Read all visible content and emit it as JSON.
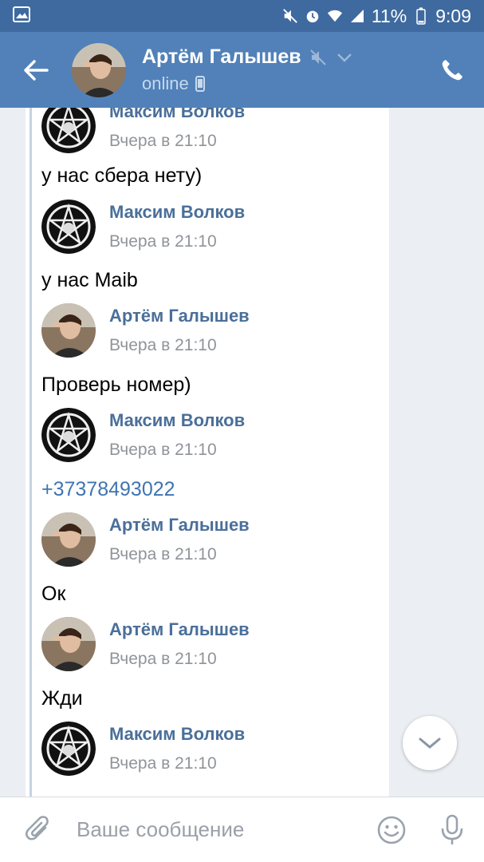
{
  "status_bar": {
    "battery": "11%",
    "time": "9:09",
    "icons": [
      "image-icon",
      "mute-icon",
      "alarm-icon",
      "wifi-icon",
      "signal-icon",
      "battery-icon"
    ]
  },
  "header": {
    "name": "Артём Галышев",
    "status": "online",
    "icons": [
      "back-arrow-icon",
      "muted-icon",
      "chevron-down-icon",
      "mobile-icon",
      "phone-icon"
    ]
  },
  "messages": [
    {
      "type": "author",
      "name": "Максим Волков",
      "time": "Вчера в 21:10",
      "avatar": "pentagram"
    },
    {
      "type": "text",
      "text": "у нас сбера нету)"
    },
    {
      "type": "author",
      "name": "Максим Волков",
      "time": "Вчера в 21:10",
      "avatar": "pentagram"
    },
    {
      "type": "text",
      "text": "у нас Maib"
    },
    {
      "type": "author",
      "name": "Артём Галышев",
      "time": "Вчера в 21:10",
      "avatar": "photo"
    },
    {
      "type": "text",
      "text": "Проверь номер)"
    },
    {
      "type": "author",
      "name": "Максим Волков",
      "time": "Вчера в 21:10",
      "avatar": "pentagram"
    },
    {
      "type": "link",
      "text": "+37378493022"
    },
    {
      "type": "author",
      "name": "Артём Галышев",
      "time": "Вчера в 21:10",
      "avatar": "photo"
    },
    {
      "type": "text",
      "text": "Ок"
    },
    {
      "type": "author",
      "name": "Артём Галышев",
      "time": "Вчера в 21:10",
      "avatar": "photo"
    },
    {
      "type": "text",
      "text": "Жди"
    },
    {
      "type": "author",
      "name": "Максим Волков",
      "time": "Вчера в 21:10",
      "avatar": "pentagram"
    }
  ],
  "composer": {
    "placeholder": "Ваше сообщение",
    "icons": [
      "paperclip-icon",
      "emoji-icon",
      "microphone-icon",
      "chevron-down-icon"
    ]
  },
  "colors": {
    "header": "#5181b8",
    "status_bar": "#3f6aa0",
    "author_name": "#4a6f9a",
    "link": "#3f74b2",
    "chat_bg": "#ebeef2"
  }
}
